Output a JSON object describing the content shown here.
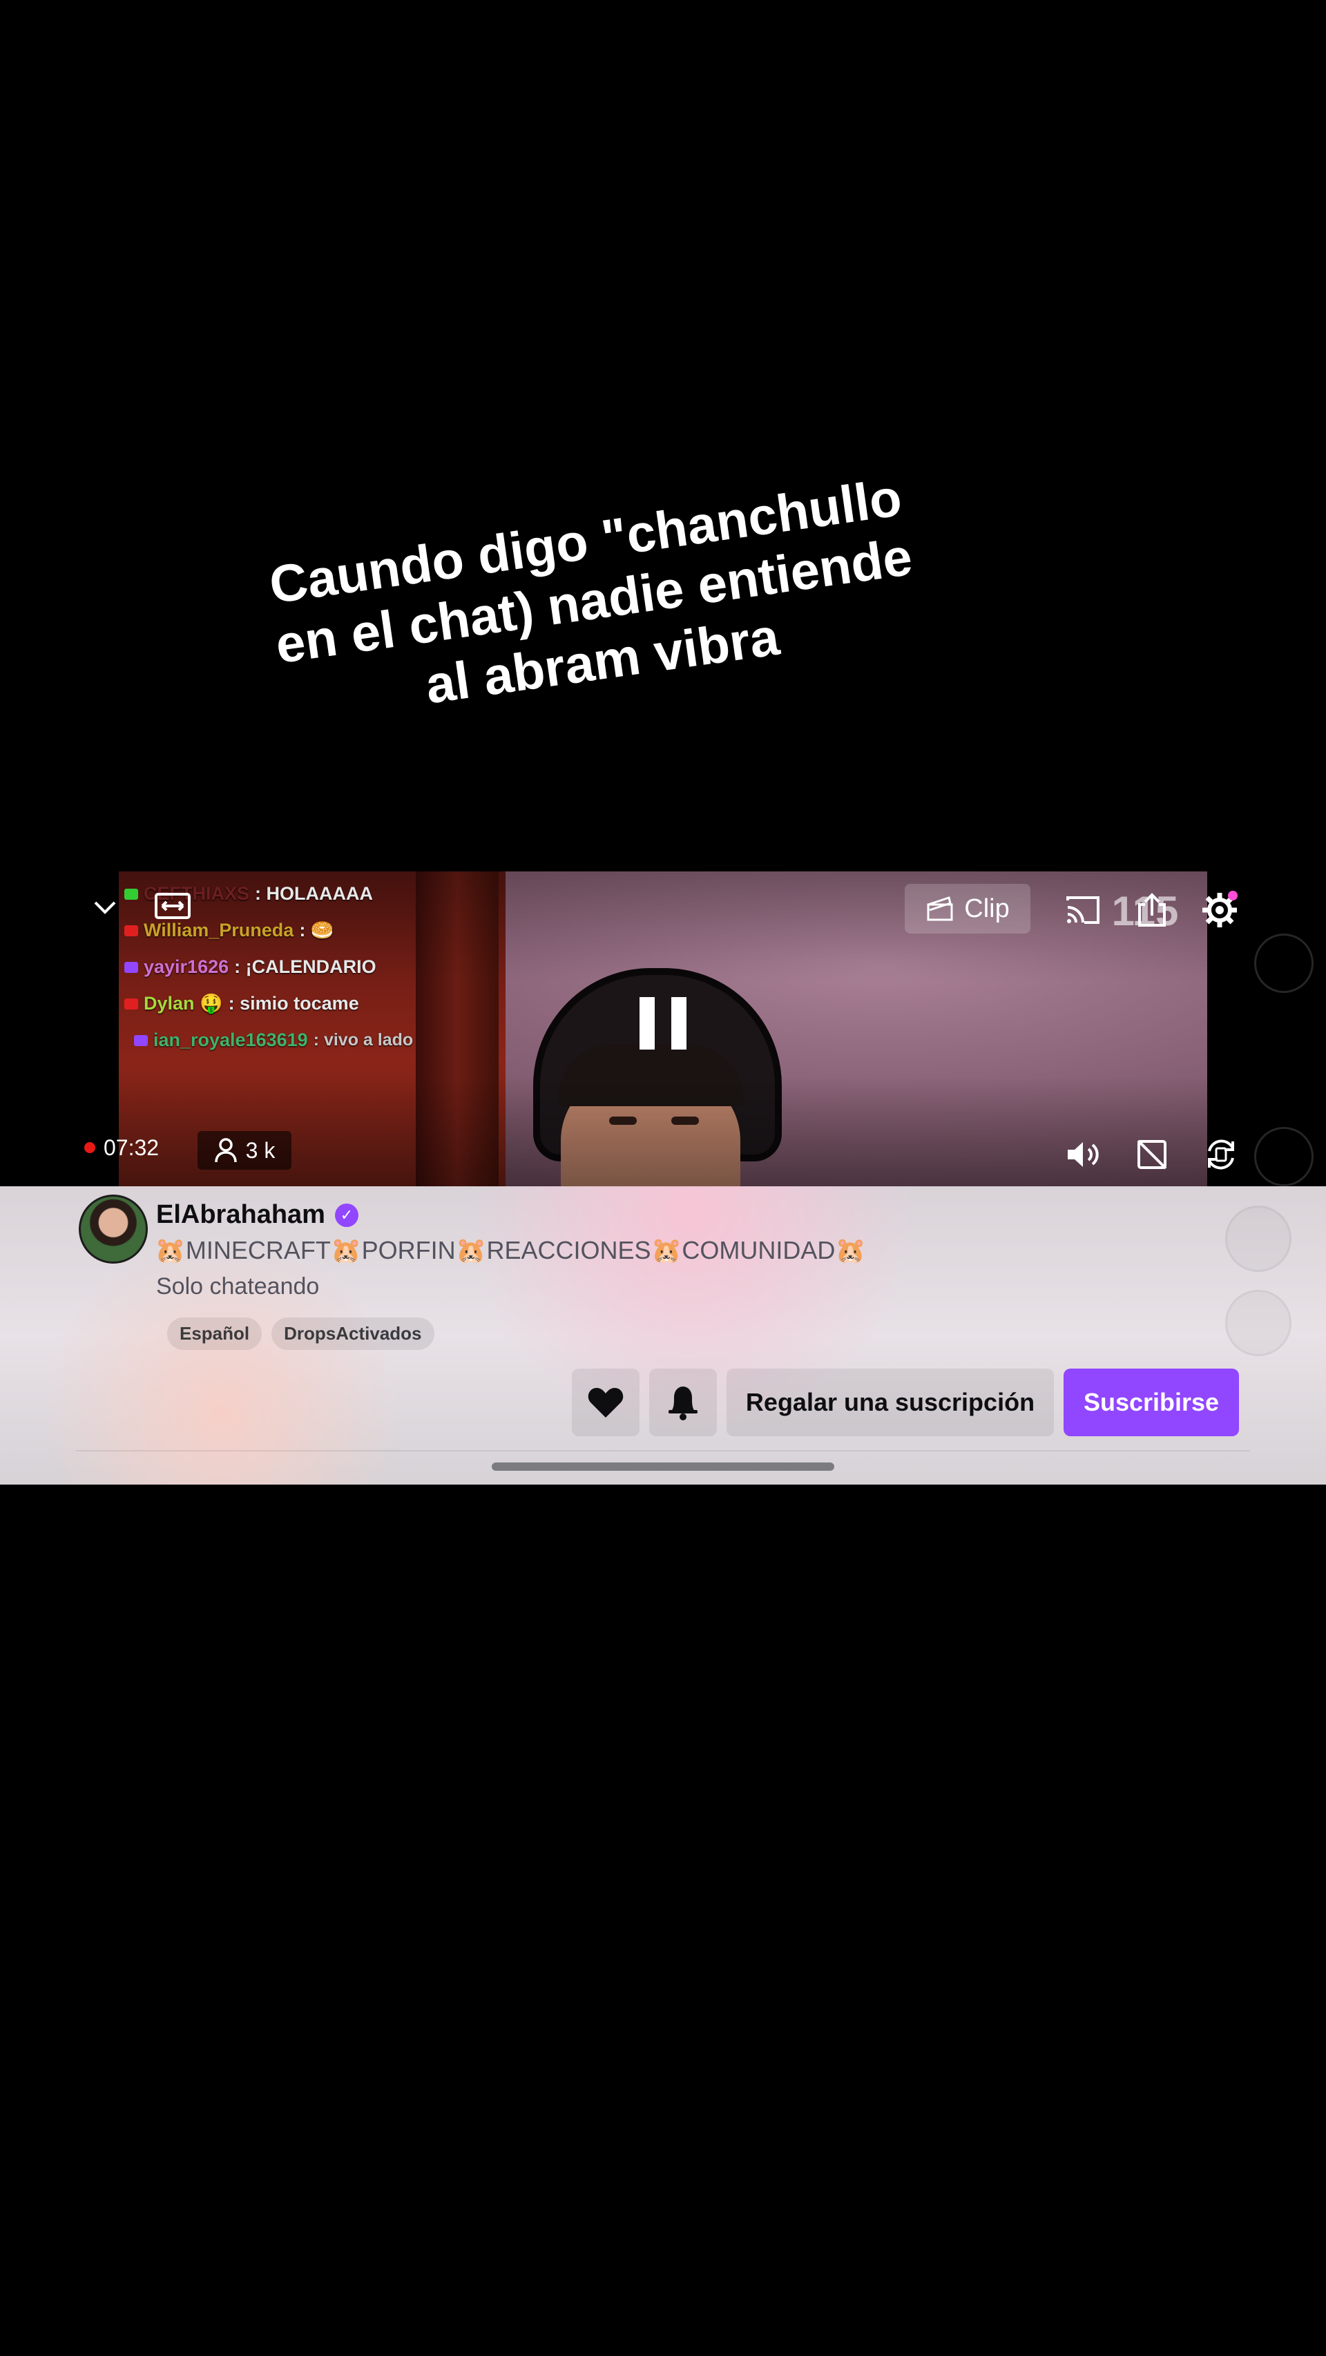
{
  "caption": {
    "line1": "Caundo digo \"chanchullo",
    "line2": "en el chat) nadie entiende",
    "line3": "al abram vibra"
  },
  "chat": [
    {
      "platform": "kick",
      "user": "CEFTHIAXS",
      "user_color": "#6b1f1f",
      "message": ": HOLAAAAA"
    },
    {
      "platform": "youtube",
      "user": "William_Pruneda",
      "user_color": "#c9a227",
      "message": ": 🥯"
    },
    {
      "platform": "twitch",
      "user": "yayir1626",
      "user_color": "#d070d0",
      "message": ": ¡CALENDARIO"
    },
    {
      "platform": "youtube",
      "user": "Dylan 🤑",
      "user_color": "#a7d93d",
      "message": ": simio tocame"
    },
    {
      "platform": "twitch",
      "user": "ian_royale163619",
      "user_color": "#3fb26a",
      "message": ": vivo a lado"
    }
  ],
  "player": {
    "clip_label": "Clip",
    "viewer_overlay": "115",
    "elapsed": "07:32",
    "viewers": "3 k"
  },
  "channel": {
    "name": "ElAbrahaham",
    "title": "🐹MINECRAFT🐹PORFIN🐹REACCIONES🐹COMUNIDAD🐹",
    "category": "Solo chateando",
    "tags": [
      "Español",
      "DropsActivados"
    ]
  },
  "actions": {
    "gift_label": "Regalar una suscripción",
    "subscribe_label": "Suscribirse"
  },
  "colors": {
    "accent": "#9146ff",
    "live": "#e91916"
  },
  "icons": [
    "chevron-down-icon",
    "expand-icon",
    "clip-icon",
    "cast-icon",
    "share-icon",
    "gear-icon",
    "pause-icon",
    "user-icon",
    "volume-icon",
    "screen-off-icon",
    "rotate-icon",
    "heart-icon",
    "bell-icon",
    "verified-icon"
  ]
}
